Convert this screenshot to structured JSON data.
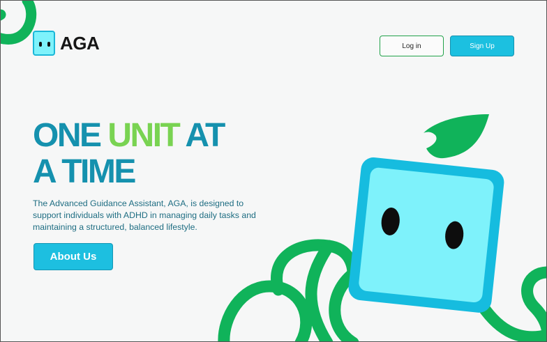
{
  "brand": {
    "name": "AGA",
    "icon": "robot-face-icon"
  },
  "header": {
    "login_label": "Log in",
    "signup_label": "Sign Up"
  },
  "hero": {
    "headline_part1": "ONE ",
    "headline_accent": "UNIT",
    "headline_part2": " AT",
    "headline_line2": "A TIME",
    "description": "The Advanced Guidance Assistant, AGA, is designed to support individuals with ADHD in managing daily tasks and maintaining a structured, balanced lifestyle.",
    "cta_label": "About Us"
  },
  "colors": {
    "primary_teal": "#1591ae",
    "accent_green": "#79d352",
    "button_cyan": "#1cc0e0",
    "vine_green": "#10b35a",
    "mascot_face": "#7ef2fb"
  }
}
